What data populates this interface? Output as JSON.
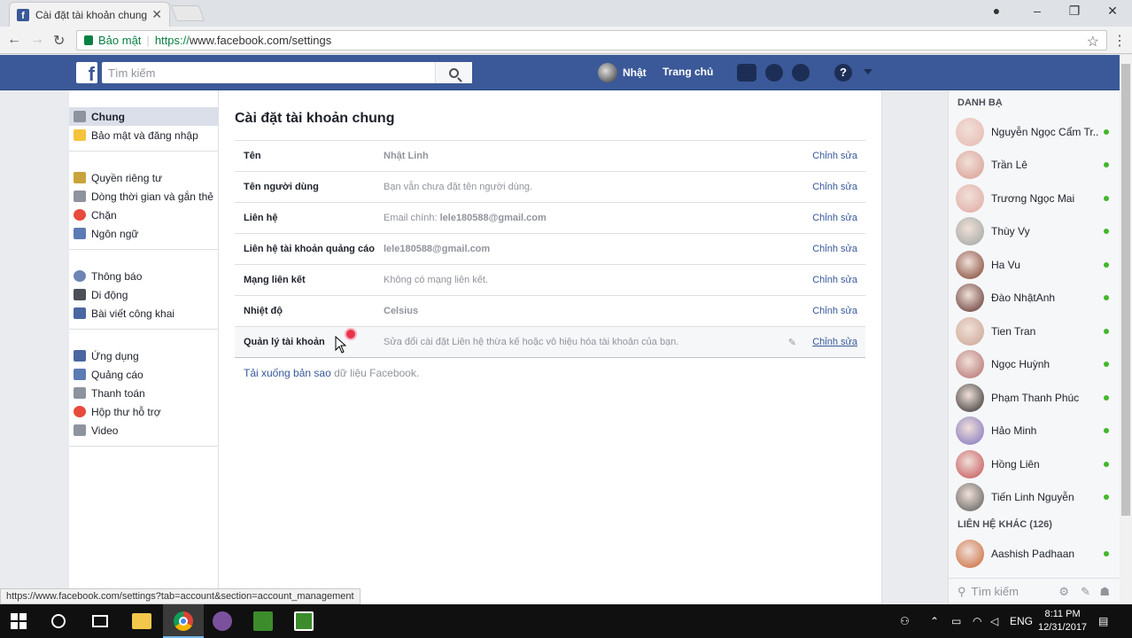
{
  "browser": {
    "tab_title": "Cài đặt tài khoản chung",
    "tab_close": "✕",
    "secure_label": "Bảo mật",
    "url_scheme": "https://",
    "url_rest": "www.facebook.com/settings",
    "status_url": "https://www.facebook.com/settings?tab=account&section=account_management"
  },
  "fbbar": {
    "search_placeholder": "Tìm kiếm",
    "user_name": "Nhật",
    "home_label": "Trang chủ"
  },
  "leftnav": {
    "groups": [
      [
        {
          "label": "Chung",
          "icon": "gear-icon",
          "active": true
        },
        {
          "label": "Bảo mật và đăng nhập",
          "icon": "badge-icon"
        }
      ],
      [
        {
          "label": "Quyền riêng tư",
          "icon": "lock-icon"
        },
        {
          "label": "Dòng thời gian và gắn thẻ",
          "icon": "timeline-icon"
        },
        {
          "label": "Chặn",
          "icon": "block-icon"
        },
        {
          "label": "Ngôn ngữ",
          "icon": "language-icon"
        }
      ],
      [
        {
          "label": "Thông báo",
          "icon": "globe-icon"
        },
        {
          "label": "Di động",
          "icon": "mobile-icon"
        },
        {
          "label": "Bài viết công khai",
          "icon": "rss-icon"
        }
      ],
      [
        {
          "label": "Ứng dụng",
          "icon": "apps-icon"
        },
        {
          "label": "Quảng cáo",
          "icon": "ads-icon"
        },
        {
          "label": "Thanh toán",
          "icon": "card-icon"
        },
        {
          "label": "Hộp thư hỗ trợ",
          "icon": "lifebuoy-icon"
        },
        {
          "label": "Video",
          "icon": "film-icon"
        }
      ]
    ]
  },
  "main": {
    "title": "Cài đặt tài khoản chung",
    "rows": [
      {
        "label": "Tên",
        "value": "Nhật Linh",
        "edit": "Chỉnh sửa"
      },
      {
        "label": "Tên người dùng",
        "value": "Bạn vẫn chưa đặt tên người dùng.",
        "edit": "Chỉnh sửa"
      },
      {
        "label": "Liên hệ",
        "value_prefix": "Email chính: ",
        "value": "lele180588@gmail.com",
        "edit": "Chỉnh sửa"
      },
      {
        "label": "Liên hệ tài khoản quảng cáo",
        "value": "lele180588@gmail.com",
        "edit": "Chỉnh sửa"
      },
      {
        "label": "Mạng liên kết",
        "value": "Không có mạng liên kết.",
        "edit": "Chỉnh sửa"
      },
      {
        "label": "Nhiệt độ",
        "value": "Celsius",
        "edit": "Chỉnh sửa"
      },
      {
        "label": "Quản lý tài khoản",
        "value": "Sửa đổi cài đặt Liên hệ thừa kế hoặc vô hiệu hóa tài khoản của bạn.",
        "edit": "Chỉnh sửa"
      }
    ],
    "download_link": "Tải xuống bản sao",
    "download_rest": " dữ liệu Facebook."
  },
  "chat": {
    "header": "DANH BẠ",
    "contacts": [
      {
        "name": "Nguyễn Ngọc Cẩm Tr...",
        "color": "#e7b7b0"
      },
      {
        "name": "Trần Lê",
        "color": "#d79a8f"
      },
      {
        "name": "Trương Ngọc Mai",
        "color": "#e0a8a0"
      },
      {
        "name": "Thùy Vy",
        "color": "#9aa3a0"
      },
      {
        "name": "Ha Vu",
        "color": "#7a3b2b"
      },
      {
        "name": "Đào NhậtAnh",
        "color": "#5a2c28"
      },
      {
        "name": "Tien Tran",
        "color": "#c9a290"
      },
      {
        "name": "Ngọc Huỳnh",
        "color": "#b06a6a"
      },
      {
        "name": "Phạm Thanh Phúc",
        "color": "#2a2a2a"
      },
      {
        "name": "Hảo Minh",
        "color": "#7a6fbf"
      },
      {
        "name": "Hồng Liên",
        "color": "#c24a50"
      },
      {
        "name": "Tiến Linh Nguyễn",
        "color": "#555"
      }
    ],
    "other_header": "LIÊN HỆ KHÁC (126)",
    "others": [
      {
        "name": "Aashish Padhaan",
        "color": "#c9622f"
      }
    ],
    "search_placeholder": "Tìm kiếm"
  },
  "taskbar": {
    "lang": "ENG",
    "time": "8:11 PM",
    "date": "12/31/2017"
  },
  "colors": {
    "fb_blue": "#3b5998",
    "link": "#365899",
    "online": "#42b72a"
  }
}
